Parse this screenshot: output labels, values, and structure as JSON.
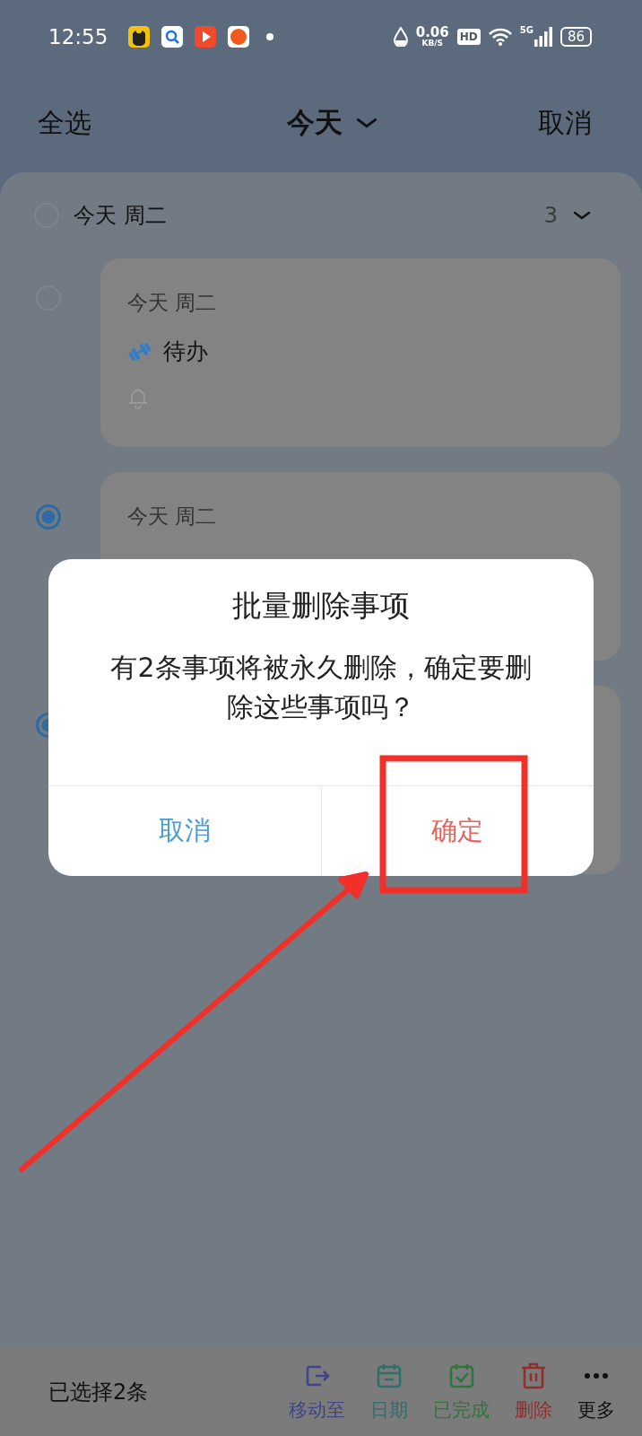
{
  "status_bar": {
    "time": "12:55",
    "speed": "0.06",
    "speed_unit": "KB/S",
    "hd": "HD",
    "network": "5G",
    "battery": "86"
  },
  "header": {
    "select_all": "全选",
    "title": "今天",
    "cancel": "取消"
  },
  "group": {
    "title": "今天 周二",
    "count": "3",
    "selected": false,
    "expanded": true
  },
  "tasks": [
    {
      "selected": false,
      "date": "今天 周二",
      "title": "待办",
      "reminder": true
    },
    {
      "selected": true,
      "date": "今天 周二"
    },
    {
      "selected": true
    }
  ],
  "dialog": {
    "title": "批量删除事项",
    "message": "有2条事项将被永久删除，确定要删除这些事项吗？",
    "buttons": [
      {
        "label": "取消",
        "kind": "cancel"
      },
      {
        "label": "确定",
        "kind": "confirm"
      }
    ]
  },
  "bottom_bar": {
    "selection": "已选择2条",
    "actions": [
      {
        "label": "移动至",
        "kind": "move",
        "color": "#40448a"
      },
      {
        "label": "日期",
        "kind": "date",
        "color": "#2f6e6b"
      },
      {
        "label": "已完成",
        "kind": "done",
        "color": "#2f7539"
      },
      {
        "label": "删除",
        "kind": "delete",
        "color": "#8e302c"
      },
      {
        "label": "更多",
        "kind": "more",
        "color": "#111111"
      }
    ]
  }
}
